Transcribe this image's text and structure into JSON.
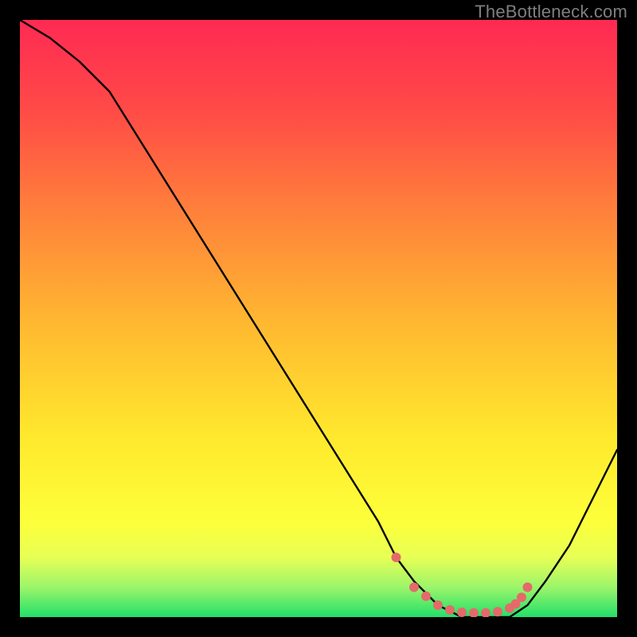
{
  "watermark": "TheBottleneck.com",
  "chart_data": {
    "type": "line",
    "title": "",
    "xlabel": "",
    "ylabel": "",
    "xlim": [
      0,
      100
    ],
    "ylim": [
      0,
      100
    ],
    "series": [
      {
        "name": "bottleneck-curve",
        "x": [
          0,
          5,
          10,
          15,
          20,
          25,
          30,
          35,
          40,
          45,
          50,
          55,
          60,
          63,
          66,
          70,
          74,
          78,
          82,
          85,
          88,
          92,
          100
        ],
        "values": [
          100,
          97,
          93,
          88,
          80,
          72,
          64,
          56,
          48,
          40,
          32,
          24,
          16,
          10,
          6,
          2,
          0,
          0,
          0,
          2,
          6,
          12,
          28
        ]
      }
    ],
    "highlight": {
      "name": "sweet-spot",
      "x": [
        63,
        66,
        68,
        70,
        72,
        74,
        76,
        78,
        80,
        82,
        83,
        84,
        85
      ],
      "values": [
        10,
        5,
        3.5,
        2,
        1.2,
        0.8,
        0.7,
        0.7,
        0.9,
        1.5,
        2.2,
        3.3,
        5
      ]
    },
    "gradient_stops": [
      {
        "offset": 0.0,
        "color": "#ff2a53"
      },
      {
        "offset": 0.15,
        "color": "#ff4a47"
      },
      {
        "offset": 0.3,
        "color": "#ff7a3c"
      },
      {
        "offset": 0.5,
        "color": "#ffb631"
      },
      {
        "offset": 0.7,
        "color": "#ffe92d"
      },
      {
        "offset": 0.84,
        "color": "#fdff3a"
      },
      {
        "offset": 0.9,
        "color": "#e7ff55"
      },
      {
        "offset": 0.95,
        "color": "#9cf56a"
      },
      {
        "offset": 1.0,
        "color": "#22e06a"
      }
    ],
    "colors": {
      "curve": "#000000",
      "highlight": "#e46a6a",
      "background_frame": "#000000"
    }
  }
}
